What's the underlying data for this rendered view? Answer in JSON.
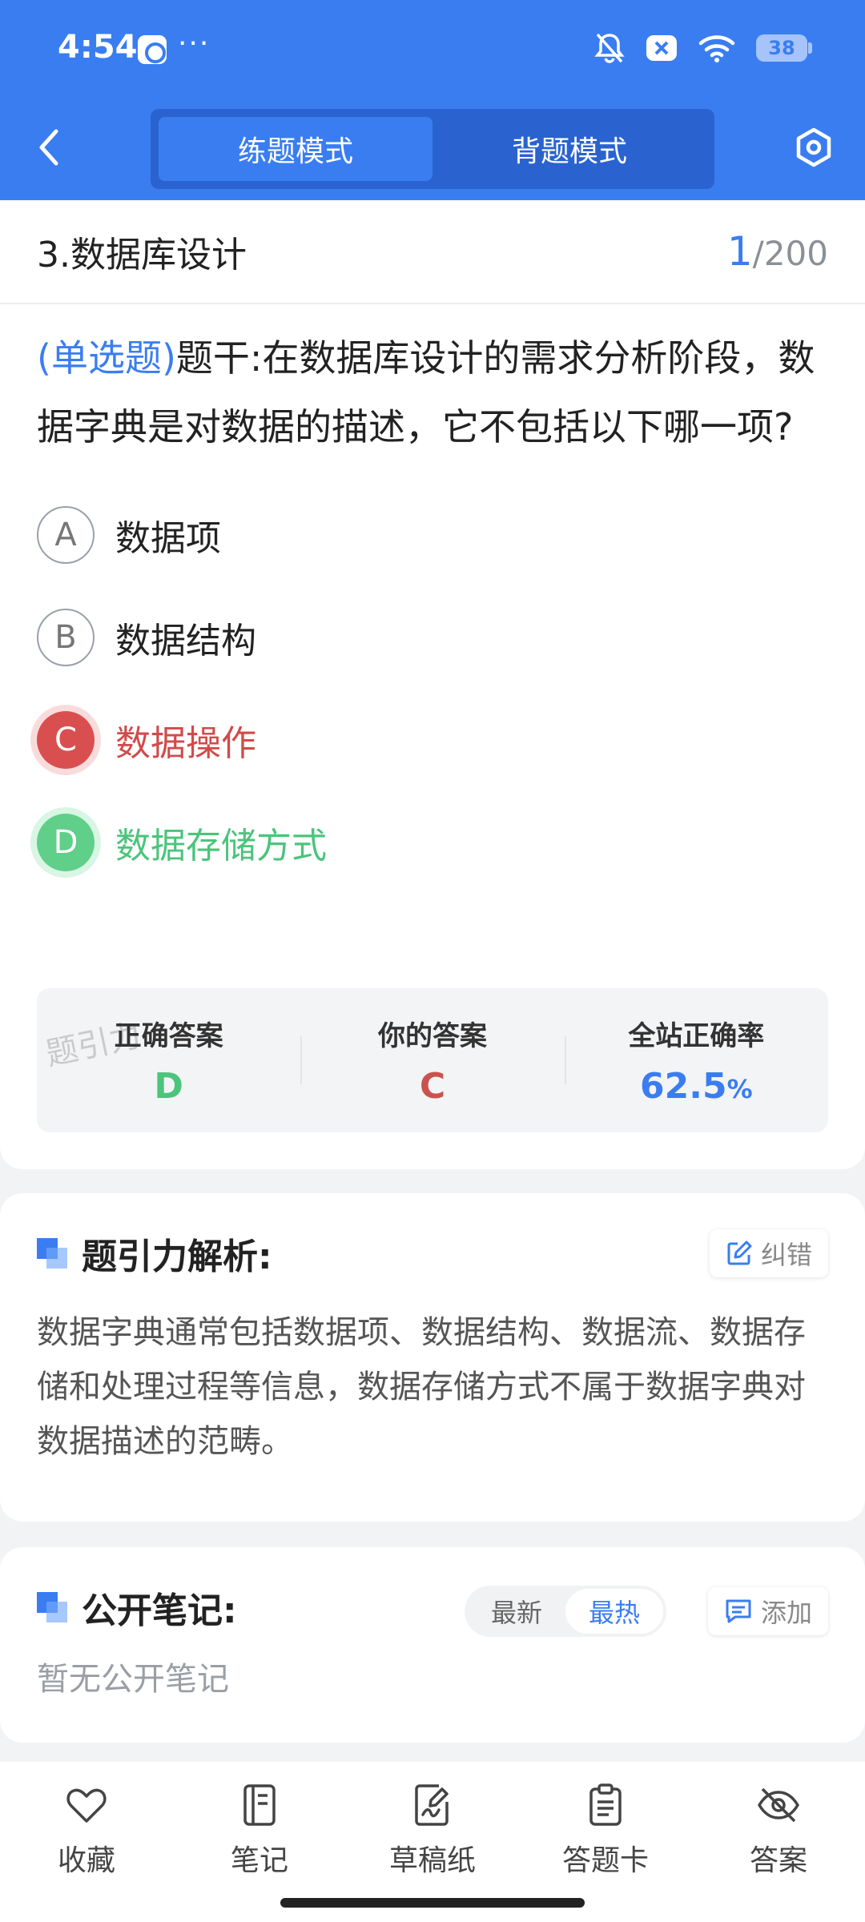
{
  "status_bar": {
    "time": "4:54",
    "more": "···",
    "battery": "38"
  },
  "header": {
    "tabs": [
      {
        "label": "练题模式",
        "active": true
      },
      {
        "label": "背题模式",
        "active": false
      }
    ]
  },
  "question": {
    "section": "3.数据库设计",
    "current": "1",
    "total": "/200",
    "type": "(单选题)",
    "stem": "题干:在数据库设计的需求分析阶段，数据字典是对数据的描述，它不包括以下哪一项?",
    "options": [
      {
        "letter": "A",
        "text": "数据项",
        "state": "normal"
      },
      {
        "letter": "B",
        "text": "数据结构",
        "state": "normal"
      },
      {
        "letter": "C",
        "text": "数据操作",
        "state": "wrong"
      },
      {
        "letter": "D",
        "text": "数据存储方式",
        "state": "right"
      }
    ],
    "stats": {
      "correct_label": "正确答案",
      "correct_value": "D",
      "yours_label": "你的答案",
      "yours_value": "C",
      "rate_label": "全站正确率",
      "rate_value": "62.5",
      "rate_unit": "%"
    },
    "watermark": "题引力"
  },
  "analysis": {
    "title": "题引力解析:",
    "report_label": "纠错",
    "text": "数据字典通常包括数据项、数据结构、数据流、数据存储和处理过程等信息，数据存储方式不属于数据字典对数据描述的范畴。"
  },
  "notes": {
    "title": "公开笔记:",
    "sort": [
      {
        "label": "最新",
        "active": false
      },
      {
        "label": "最热",
        "active": true
      }
    ],
    "add_label": "添加",
    "empty_text": "暂无公开笔记"
  },
  "bottom_bar": {
    "items": [
      {
        "label": "收藏",
        "icon": "heart-icon"
      },
      {
        "label": "笔记",
        "icon": "notebook-icon"
      },
      {
        "label": "草稿纸",
        "icon": "draft-icon"
      },
      {
        "label": "答题卡",
        "icon": "clipboard-icon"
      },
      {
        "label": "答案",
        "icon": "eye-off-icon"
      }
    ]
  },
  "colors": {
    "primary": "#3a7df1",
    "correct": "#4bc47c",
    "wrong": "#d24a4a"
  }
}
